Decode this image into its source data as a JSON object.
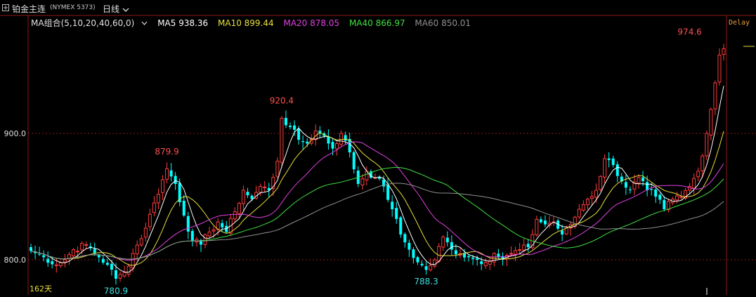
{
  "header": {
    "icon": "app-icon",
    "title": "铂金主连",
    "code": "(NYMEX 5373)",
    "period": "日线",
    "period_chevron": "chevron-down-icon"
  },
  "legend": {
    "group": "MA组合(5,10,20,40,60,0)",
    "ma5": "MA5 938.36",
    "ma10": "MA10 899.44",
    "ma20": "MA20 878.05",
    "ma40": "MA40 866.97",
    "ma60": "MA60 850.01",
    "colors": {
      "ma5": "#ffffff",
      "ma10": "#e8e03c",
      "ma20": "#e040e0",
      "ma40": "#40e040",
      "ma60": "#909090"
    }
  },
  "status": {
    "delay": "Delay",
    "days": "162天"
  },
  "colors": {
    "up": "#ff3c3c",
    "down": "#00ffff",
    "grid": "#8b1a1a",
    "axis": "#8b1a1a"
  },
  "chart_data": {
    "type": "candlestick",
    "ylim": [
      770,
      980
    ],
    "yticks": [
      {
        "value": 800,
        "label": "800.0"
      },
      {
        "value": 900,
        "label": "900.0"
      }
    ],
    "annotations": [
      {
        "label": "974.6",
        "index": 155,
        "value": 974.6,
        "kind": "high"
      },
      {
        "label": "920.4",
        "index": 59,
        "value": 920.4,
        "kind": "high"
      },
      {
        "label": "879.9",
        "index": 32,
        "value": 879.9,
        "kind": "high"
      },
      {
        "label": "780.9",
        "index": 20,
        "value": 780.9,
        "kind": "low"
      },
      {
        "label": "788.3",
        "index": 93,
        "value": 788.3,
        "kind": "low"
      }
    ],
    "anchors": [
      [
        0,
        807
      ],
      [
        3,
        802
      ],
      [
        6,
        796
      ],
      [
        8,
        800
      ],
      [
        10,
        808
      ],
      [
        13,
        812
      ],
      [
        16,
        802
      ],
      [
        18,
        796
      ],
      [
        20,
        785
      ],
      [
        22,
        790
      ],
      [
        24,
        805
      ],
      [
        27,
        825
      ],
      [
        29,
        845
      ],
      [
        32,
        872
      ],
      [
        34,
        860
      ],
      [
        36,
        835
      ],
      [
        38,
        815
      ],
      [
        40,
        812
      ],
      [
        42,
        822
      ],
      [
        44,
        830
      ],
      [
        46,
        822
      ],
      [
        48,
        838
      ],
      [
        50,
        855
      ],
      [
        52,
        848
      ],
      [
        54,
        858
      ],
      [
        56,
        855
      ],
      [
        58,
        878
      ],
      [
        59,
        912
      ],
      [
        61,
        905
      ],
      [
        63,
        895
      ],
      [
        65,
        892
      ],
      [
        67,
        902
      ],
      [
        69,
        898
      ],
      [
        71,
        888
      ],
      [
        73,
        900
      ],
      [
        75,
        885
      ],
      [
        77,
        860
      ],
      [
        79,
        870
      ],
      [
        81,
        865
      ],
      [
        83,
        858
      ],
      [
        85,
        840
      ],
      [
        87,
        820
      ],
      [
        89,
        808
      ],
      [
        91,
        798
      ],
      [
        93,
        792
      ],
      [
        95,
        800
      ],
      [
        97,
        818
      ],
      [
        99,
        808
      ],
      [
        101,
        805
      ],
      [
        103,
        802
      ],
      [
        105,
        800
      ],
      [
        107,
        798
      ],
      [
        109,
        805
      ],
      [
        111,
        800
      ],
      [
        113,
        805
      ],
      [
        115,
        808
      ],
      [
        117,
        810
      ],
      [
        119,
        832
      ],
      [
        121,
        828
      ],
      [
        123,
        830
      ],
      [
        125,
        820
      ],
      [
        127,
        828
      ],
      [
        129,
        840
      ],
      [
        131,
        848
      ],
      [
        133,
        855
      ],
      [
        135,
        880
      ],
      [
        137,
        875
      ],
      [
        139,
        862
      ],
      [
        141,
        855
      ],
      [
        143,
        865
      ],
      [
        145,
        855
      ],
      [
        147,
        850
      ],
      [
        149,
        840
      ],
      [
        151,
        848
      ],
      [
        153,
        850
      ],
      [
        155,
        858
      ],
      [
        157,
        870
      ],
      [
        159,
        900
      ],
      [
        161,
        940
      ],
      [
        162,
        962
      ],
      [
        163,
        967
      ]
    ],
    "seed": 7,
    "series": [
      {
        "name": "MA5",
        "period": 5
      },
      {
        "name": "MA10",
        "period": 10
      },
      {
        "name": "MA20",
        "period": 20
      },
      {
        "name": "MA40",
        "period": 40
      },
      {
        "name": "MA60",
        "period": 60
      }
    ]
  }
}
